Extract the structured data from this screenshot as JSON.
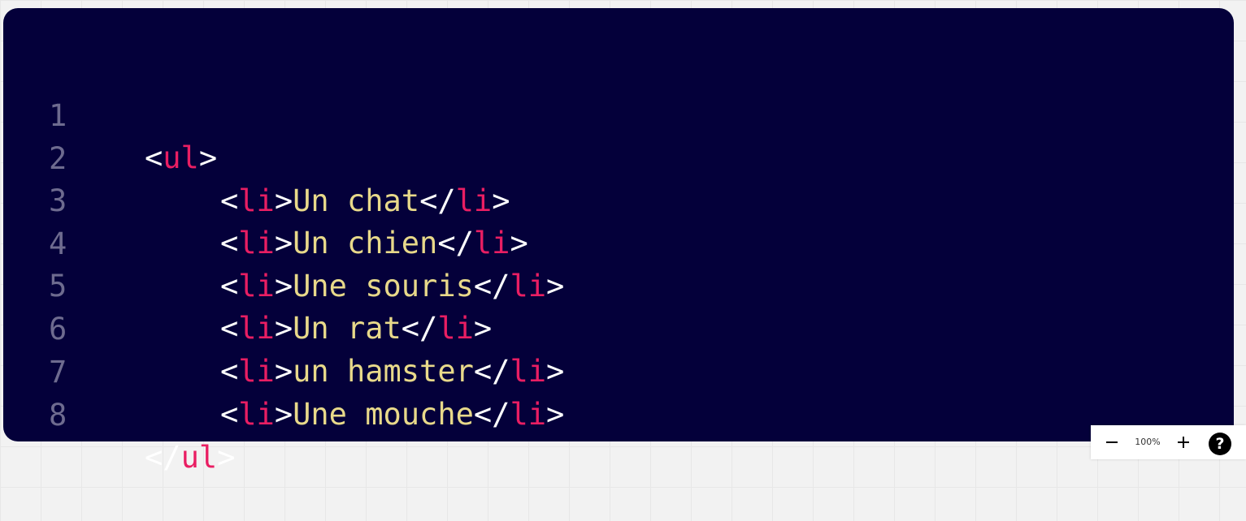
{
  "code_block": {
    "lines": [
      {
        "number": "1",
        "open": "<",
        "tag": "ul",
        "close": ">"
      },
      {
        "number": "2",
        "open": "<",
        "tag": "li",
        "mid": ">",
        "text": "Un chat",
        "end_open": "</",
        "end_tag": "li",
        "end_close": ">"
      },
      {
        "number": "3",
        "open": "<",
        "tag": "li",
        "mid": ">",
        "text": "Un chien",
        "end_open": "</",
        "end_tag": "li",
        "end_close": ">"
      },
      {
        "number": "4",
        "open": "<",
        "tag": "li",
        "mid": ">",
        "text": "Une souris",
        "end_open": "</",
        "end_tag": "li",
        "end_close": ">"
      },
      {
        "number": "5",
        "open": "<",
        "tag": "li",
        "mid": ">",
        "text": "Un rat",
        "end_open": "</",
        "end_tag": "li",
        "end_close": ">"
      },
      {
        "number": "6",
        "open": "<",
        "tag": "li",
        "mid": ">",
        "text": "un hamster",
        "end_open": "</",
        "end_tag": "li",
        "end_close": ">"
      },
      {
        "number": "7",
        "open": "<",
        "tag": "li",
        "mid": ">",
        "text": "Une mouche",
        "end_open": "</",
        "end_tag": "li",
        "end_close": ">"
      },
      {
        "number": "8",
        "open": "</",
        "tag": "ul",
        "close": ">"
      }
    ],
    "colors": {
      "background": "#04003a",
      "line_number": "#6e6b8f",
      "punctuation": "#ffffff",
      "tag": "#e91e63",
      "text": "#e8d98a"
    }
  },
  "zoom_controls": {
    "zoom_level": "100%",
    "minus_icon": "minus-icon",
    "plus_icon": "plus-icon",
    "help_icon": "question-mark-icon",
    "help_label": "?"
  }
}
